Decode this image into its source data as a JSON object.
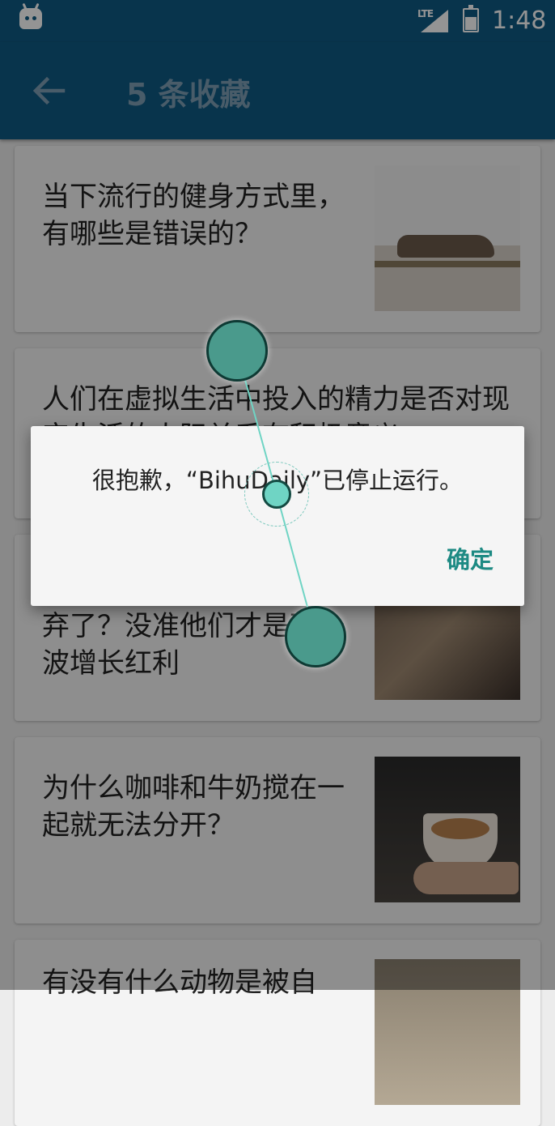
{
  "status_bar": {
    "network": "LTE",
    "time": "1:48"
  },
  "app_bar": {
    "title": "5 条收藏"
  },
  "favorites": [
    {
      "title": "当下流行的健身方式里，有哪些是错误的？"
    },
    {
      "title": "人们在虚拟生活中投入的精力是否对现实生活的人际关系有积极意义"
    },
    {
      "title": "弃了？没准他们才是下一波增长红利"
    },
    {
      "title": "为什么咖啡和牛奶搅在一起就无法分开？"
    },
    {
      "title": "有没有什么动物是被自"
    }
  ],
  "dialog": {
    "message": "很抱歉，“BihuDaily”已停止运行。",
    "ok_label": "确定"
  },
  "colors": {
    "app_bar": "#0f5a84",
    "dialog_accent": "#1d8a83",
    "touch_indicator": "#6fd4c4"
  }
}
